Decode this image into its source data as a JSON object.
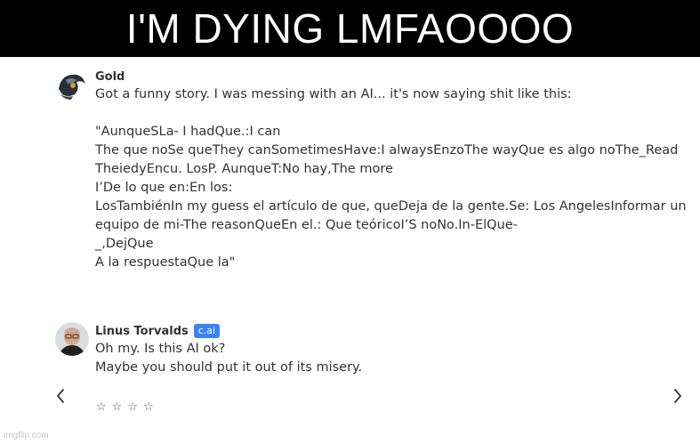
{
  "banner": {
    "caption": "I'M DYING LMFAOOOO"
  },
  "messages": [
    {
      "name": "Gold",
      "badge": "",
      "lines": [
        "Got a funny story. I was messing with an AI... it's now saying shit like this:",
        "",
        "\"AunqueSLa- I hadQue.:I can",
        "The que noSe queThey canSometimesHave:I alwaysEnzoThe wayQue es algo noThe_Read",
        "TheiedyEncu. LosP. AunqueT:No hay,The more",
        "I’De lo que en:En los:",
        "LosTambiénIn my guess el artículo de que, queDeja de la gente.Se: Los AngelesInformar un",
        "equipo de mi-The reasonQueEn el.: Que teóricoI’S noNo.In-ElQue-",
        "_,DejQue",
        "A la respuestaQue la\""
      ]
    },
    {
      "name": "Linus Torvalds",
      "badge": "c.ai",
      "lines": [
        "Oh my. Is this AI ok?",
        "Maybe you should put it out of its misery."
      ]
    }
  ],
  "rating": {
    "stars": [
      "☆",
      "☆",
      "☆",
      "☆"
    ]
  },
  "navigation": {
    "prev_icon": "chevron-left-icon",
    "next_icon": "chevron-right-icon"
  },
  "watermark": "imgflip.com"
}
